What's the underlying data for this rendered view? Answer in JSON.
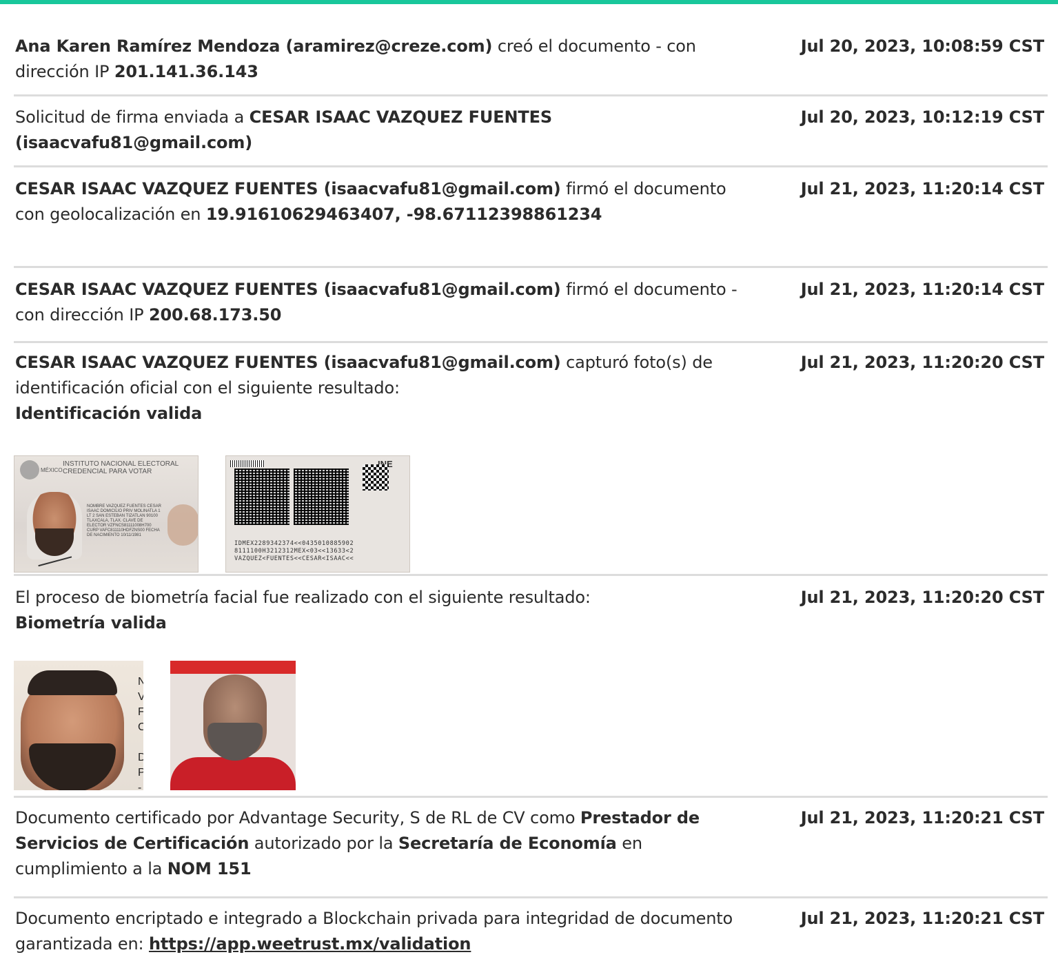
{
  "events": [
    {
      "parts": [
        {
          "text": "Ana Karen Ramírez Mendoza (aramirez@creze.com)",
          "bold": true
        },
        {
          "text": " creó el documento - con dirección IP ",
          "bold": false
        },
        {
          "text": "201.141.36.143",
          "bold": true
        }
      ],
      "date": "Jul 20, 2023, 10:08:59 CST"
    },
    {
      "parts": [
        {
          "text": "Solicitud de firma enviada a ",
          "bold": false
        },
        {
          "text": "CESAR ISAAC VAZQUEZ FUENTES (isaacvafu81@gmail.com)",
          "bold": true
        }
      ],
      "date": "Jul 20, 2023, 10:12:19 CST"
    },
    {
      "parts": [
        {
          "text": "CESAR ISAAC VAZQUEZ FUENTES (isaacvafu81@gmail.com)",
          "bold": true
        },
        {
          "text": " firmó el documento con geolocalización en ",
          "bold": false
        },
        {
          "text": "19.91610629463407, -98.67112398861234",
          "bold": true
        }
      ],
      "date": "Jul 21, 2023, 11:20:14 CST"
    },
    {
      "parts": [
        {
          "text": "CESAR ISAAC VAZQUEZ FUENTES (isaacvafu81@gmail.com)",
          "bold": true
        },
        {
          "text": " firmó el documento - con dirección IP ",
          "bold": false
        },
        {
          "text": "200.68.173.50",
          "bold": true
        }
      ],
      "date": "Jul 21, 2023, 11:20:14 CST"
    },
    {
      "parts": [
        {
          "text": "CESAR ISAAC VAZQUEZ FUENTES (isaacvafu81@gmail.com)",
          "bold": true
        },
        {
          "text": " capturó foto(s) de identificación oficial con el siguiente resultado:",
          "bold": false
        }
      ],
      "result": "Identificación valida",
      "date": "Jul 21, 2023, 11:20:20 CST"
    },
    {
      "parts": [
        {
          "text": "El proceso de biometría facial fue realizado con el siguiente resultado:",
          "bold": false
        }
      ],
      "result": "Biometría valida",
      "date": "Jul 21, 2023, 11:20:20 CST"
    },
    {
      "parts": [
        {
          "text": "Documento certificado por Advantage Security, S de RL de CV como ",
          "bold": false
        },
        {
          "text": "Prestador de Servicios de Certificación",
          "bold": true
        },
        {
          "text": " autorizado por la ",
          "bold": false
        },
        {
          "text": "Secretaría de Economía",
          "bold": true
        },
        {
          "text": " en cumplimiento a la ",
          "bold": false
        },
        {
          "text": "NOM 151",
          "bold": true
        }
      ],
      "date": "Jul 21, 2023, 11:20:21 CST"
    },
    {
      "parts": [
        {
          "text": "Documento encriptado e integrado a Blockchain privada para integridad de documento garantizada en: ",
          "bold": false
        }
      ],
      "link": "https://app.weetrust.mx/validation",
      "date": "Jul 21, 2023, 11:20:21 CST"
    }
  ],
  "id_front": {
    "country": "MÉXICO",
    "header_line1": "INSTITUTO NACIONAL ELECTORAL",
    "header_line2": "CREDENCIAL PARA VOTAR",
    "details": "NOMBRE VAZQUEZ FUENTES CESAR ISAAC DOMICILIO PRIV MOLINATLA 1 LT 2 SAN ESTEBAN TIZATLAN 90100 TLAXCALA, TLAX. CLAVE DE ELECTOR VZFNCS81111008H700 CURP VAFC811110HDFZNS00 FECHA DE NACIMIENTO 10/11/1981"
  },
  "id_back": {
    "brand": "INE",
    "mrz": "IDMEX2289342374<<0435010885902\n8111100H3212312MEX<03<<13633<2\nVAZQUEZ<FUENTES<<CESAR<ISAAC<<"
  },
  "photo_side_letters": "N\nV\nF\nC\n\nD\nP\n-\nT"
}
